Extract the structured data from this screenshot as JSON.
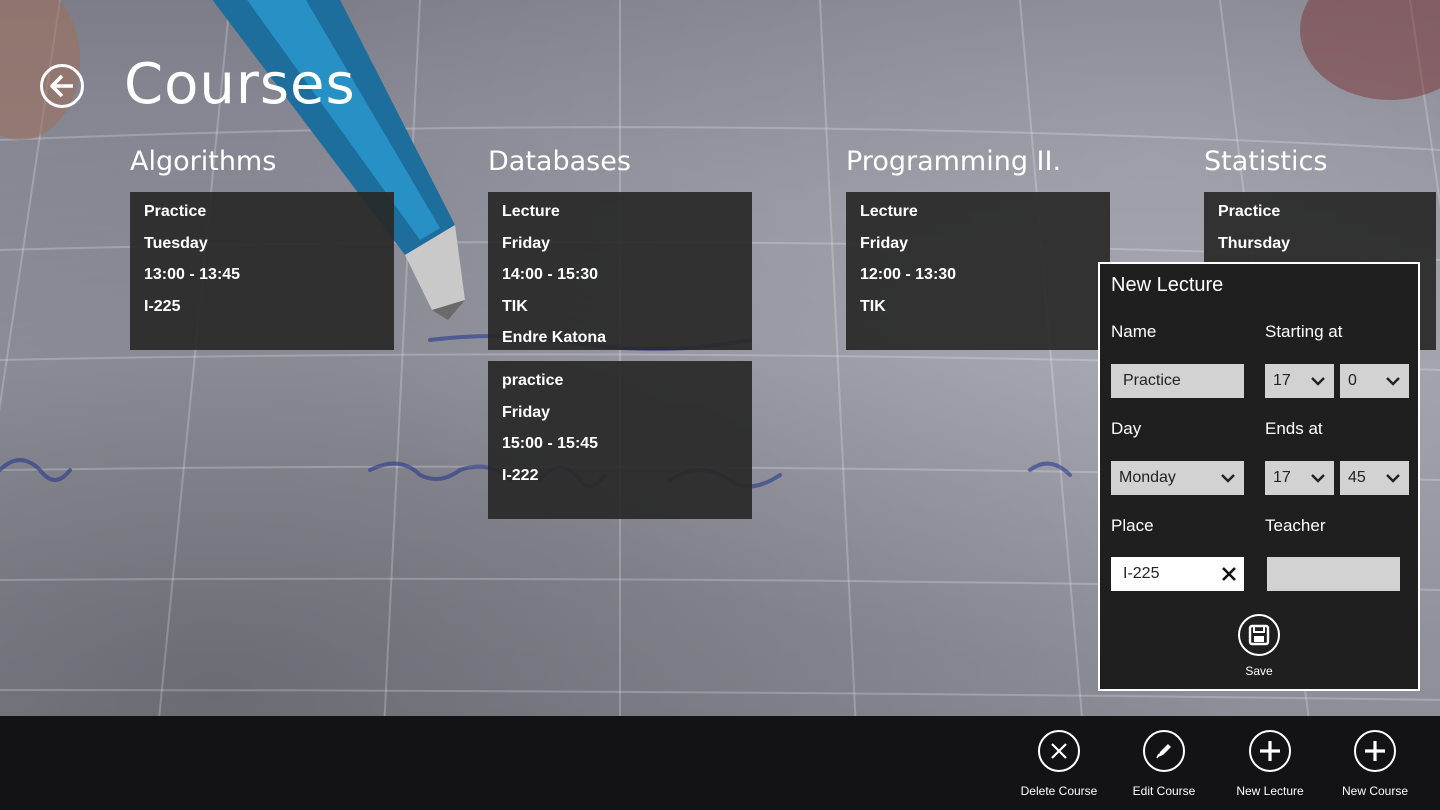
{
  "page": {
    "title": "Courses"
  },
  "courses": [
    {
      "name": "Algorithms",
      "lectures": [
        {
          "lines": [
            "Practice",
            "Tuesday",
            "13:00  -  13:45",
            "I-225"
          ]
        }
      ]
    },
    {
      "name": "Databases",
      "lectures": [
        {
          "lines": [
            "Lecture",
            "Friday",
            "14:00  -  15:30",
            "TIK",
            "Endre Katona"
          ]
        },
        {
          "lines": [
            "practice",
            "Friday",
            "15:00  -  15:45",
            "I-222"
          ]
        }
      ]
    },
    {
      "name": "Programming II.",
      "lectures": [
        {
          "lines": [
            "Lecture",
            "Friday",
            "12:00  -  13:30",
            "TIK"
          ]
        }
      ]
    },
    {
      "name": "Statistics",
      "lectures": [
        {
          "lines": [
            "Practice",
            "Thursday"
          ]
        }
      ]
    }
  ],
  "new_lecture": {
    "title": "New Lecture",
    "name_label": "Name",
    "name_value": "Practice",
    "starting_label": "Starting at",
    "start_hour": "17",
    "start_minute": "0",
    "day_label": "Day",
    "day_value": "Monday",
    "ends_label": "Ends at",
    "end_hour": "17",
    "end_minute": "45",
    "place_label": "Place",
    "place_value": "I-225",
    "teacher_label": "Teacher",
    "teacher_value": "",
    "save_label": "Save"
  },
  "app_bar": {
    "delete_course": "Delete Course",
    "edit_course": "Edit Course",
    "new_lecture": "New Lecture",
    "new_course": "New Course"
  },
  "icons": [
    "back-arrow-icon",
    "chevron-down-icon",
    "clear-icon",
    "save-icon",
    "delete-icon",
    "edit-icon",
    "add-icon"
  ]
}
